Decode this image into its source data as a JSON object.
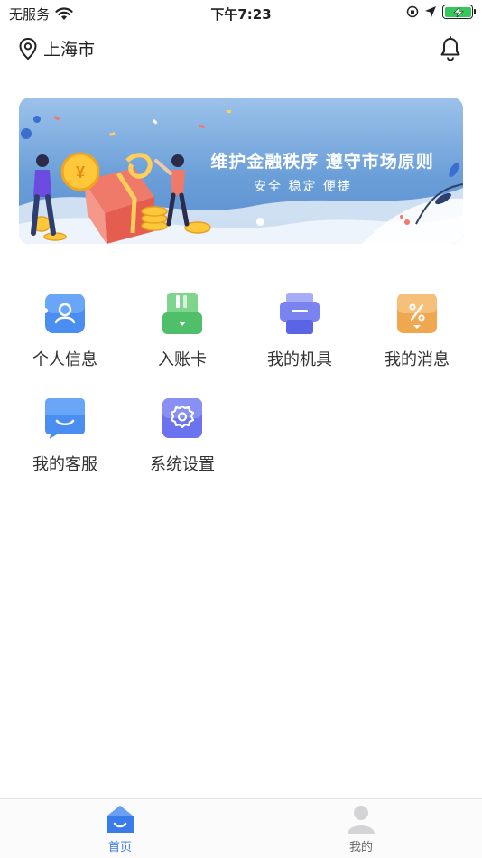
{
  "status_bar": {
    "carrier": "无服务",
    "time": "下午7:23",
    "icons": [
      "wifi-icon",
      "orientation-lock-icon",
      "location-arrow-icon",
      "battery-charging-icon"
    ]
  },
  "header": {
    "location": "上海市",
    "icons": [
      "location-pin-icon",
      "bell-icon"
    ]
  },
  "banner": {
    "title": "维护金融秩序 遵守市场原则",
    "subtitle": "安全 稳定 便捷",
    "page_count": 1,
    "current_page": 1
  },
  "menu": {
    "items": [
      {
        "label": "个人信息",
        "icon": "user-card-icon",
        "color": "#4a8ef2"
      },
      {
        "label": "入账卡",
        "icon": "bank-card-icon",
        "color": "#4fbf6a"
      },
      {
        "label": "我的机具",
        "icon": "pos-machine-icon",
        "color": "#7b83f0"
      },
      {
        "label": "我的消息",
        "icon": "discount-message-icon",
        "color": "#f0a850"
      },
      {
        "label": "我的客服",
        "icon": "customer-service-icon",
        "color": "#4a8ef2"
      },
      {
        "label": "系统设置",
        "icon": "settings-gear-icon",
        "color": "#6b74ee"
      }
    ]
  },
  "tab_bar": {
    "tabs": [
      {
        "label": "首页",
        "icon": "home-icon",
        "active": true
      },
      {
        "label": "我的",
        "icon": "profile-icon",
        "active": false
      }
    ],
    "active_color": "#3a7bea",
    "inactive_color": "#c9c9cc"
  }
}
